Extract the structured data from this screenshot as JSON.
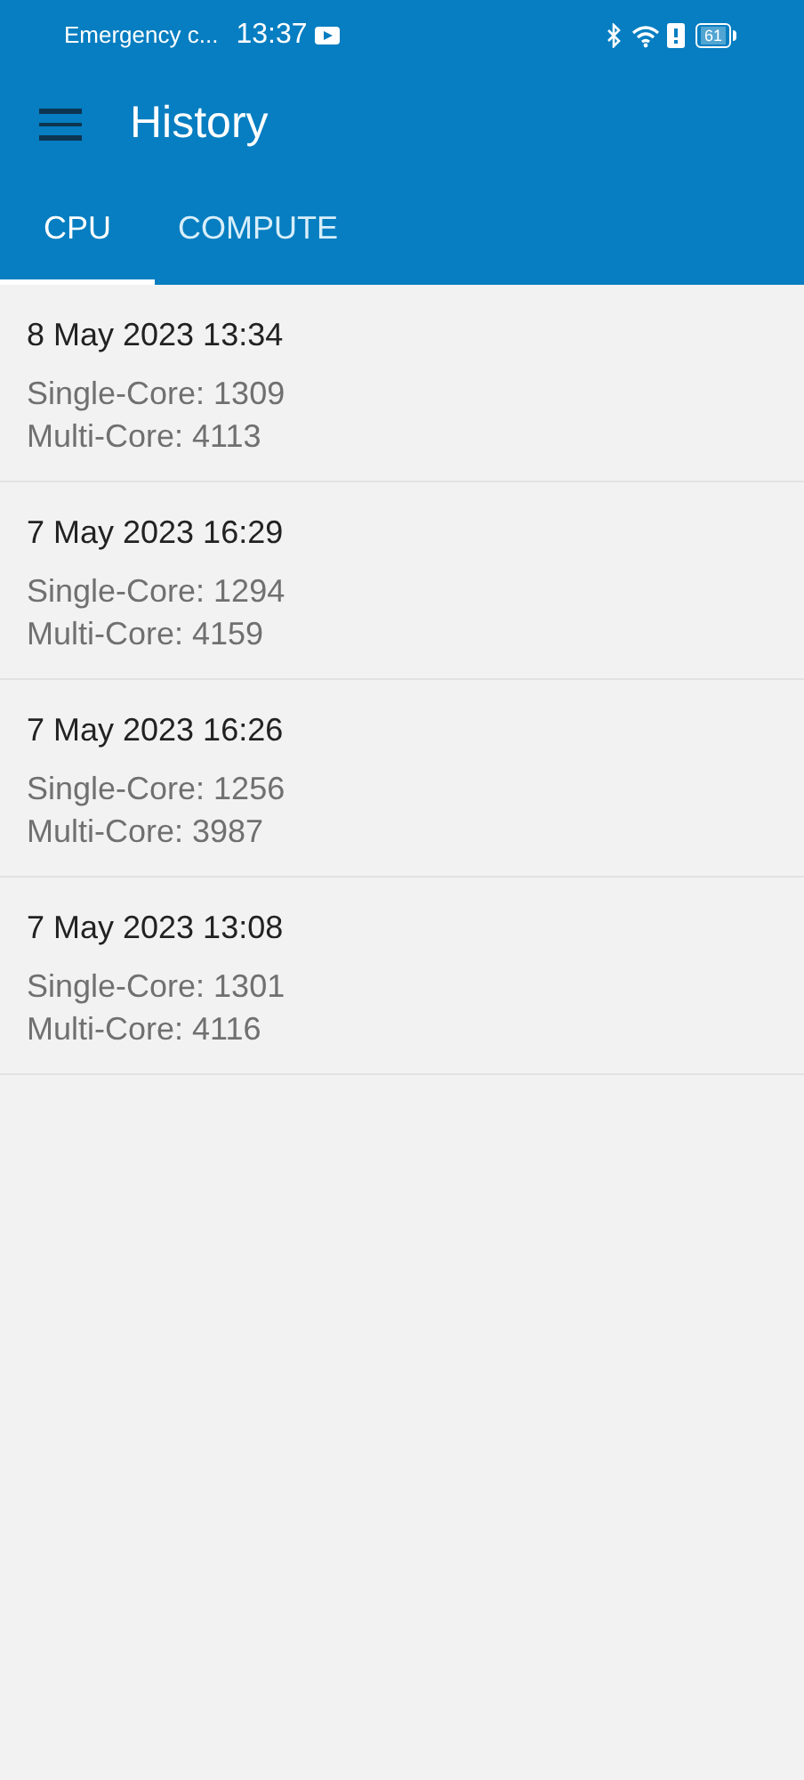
{
  "status_bar": {
    "carrier": "Emergency c...",
    "time": "13:37",
    "battery": "61"
  },
  "app_bar": {
    "title": "History"
  },
  "tabs": [
    {
      "label": "CPU",
      "selected": true
    },
    {
      "label": "COMPUTE",
      "selected": false
    }
  ],
  "results": [
    {
      "date": "8 May 2023 13:34",
      "single_core": "Single-Core: 1309",
      "multi_core": "Multi-Core: 4113"
    },
    {
      "date": "7 May 2023 16:29",
      "single_core": "Single-Core: 1294",
      "multi_core": "Multi-Core: 4159"
    },
    {
      "date": "7 May 2023 16:26",
      "single_core": "Single-Core: 1256",
      "multi_core": "Multi-Core: 3987"
    },
    {
      "date": "7 May 2023 13:08",
      "single_core": "Single-Core: 1301",
      "multi_core": "Multi-Core: 4116"
    }
  ]
}
